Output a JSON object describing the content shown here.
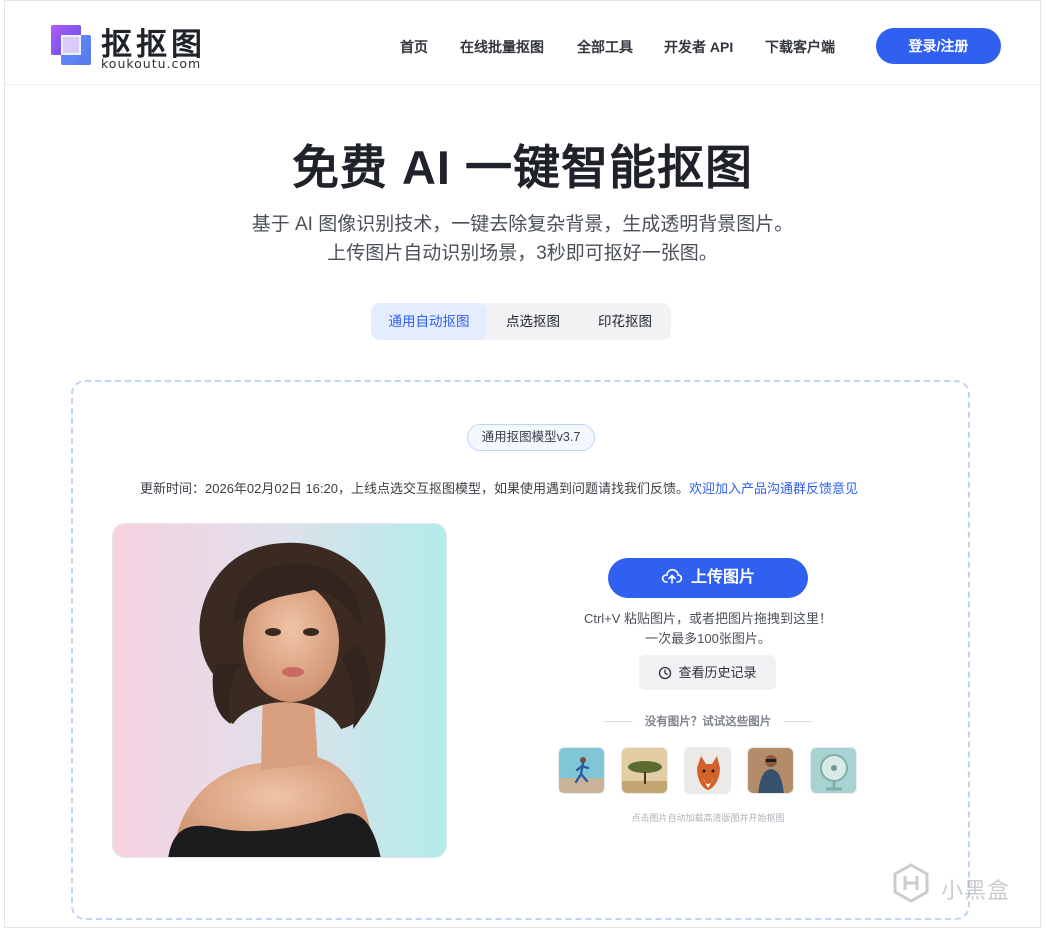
{
  "brand": {
    "name": "抠抠图",
    "domain": "koukoutu.com"
  },
  "nav": {
    "items": [
      {
        "label": "首页"
      },
      {
        "label": "在线批量抠图"
      },
      {
        "label": "全部工具"
      },
      {
        "label": "开发者 API"
      },
      {
        "label": "下载客户端"
      }
    ],
    "login_label": "登录/注册"
  },
  "hero": {
    "title": "免费 AI 一键智能抠图",
    "subtitle_line1": "基于 AI 图像识别技术，一键去除复杂背景，生成透明背景图片。",
    "subtitle_line2": "上传图片自动识别场景，3秒即可抠好一张图。"
  },
  "tabs": [
    {
      "label": "通用自动抠图",
      "active": true
    },
    {
      "label": "点选抠图",
      "active": false
    },
    {
      "label": "印花抠图",
      "active": false
    }
  ],
  "panel": {
    "model_badge": "通用抠图模型v3.7",
    "update_text": "更新时间：2026年02月02日 16:20，上线点选交互抠图模型，如果使用遇到问题请找我们反馈。",
    "feedback_link": "欢迎加入产品沟通群反馈意见",
    "upload_label": "上传图片",
    "paste_hint": "Ctrl+V 粘贴图片，或者把图片拖拽到这里！",
    "limit_hint": "一次最多100张图片。",
    "history_label": "查看历史记录",
    "try_label": "没有图片？试试这些图片",
    "sample_note": "点击图片自动加载高清版图并开始抠图",
    "samples": [
      {
        "icon": "sample-runner"
      },
      {
        "icon": "sample-tree"
      },
      {
        "icon": "sample-fox"
      },
      {
        "icon": "sample-man"
      },
      {
        "icon": "sample-fan"
      }
    ]
  },
  "watermark": "小黑盒",
  "colors": {
    "accent": "#2f60f0",
    "dashed_border": "#bcd6f5",
    "link": "#2f60f0"
  }
}
